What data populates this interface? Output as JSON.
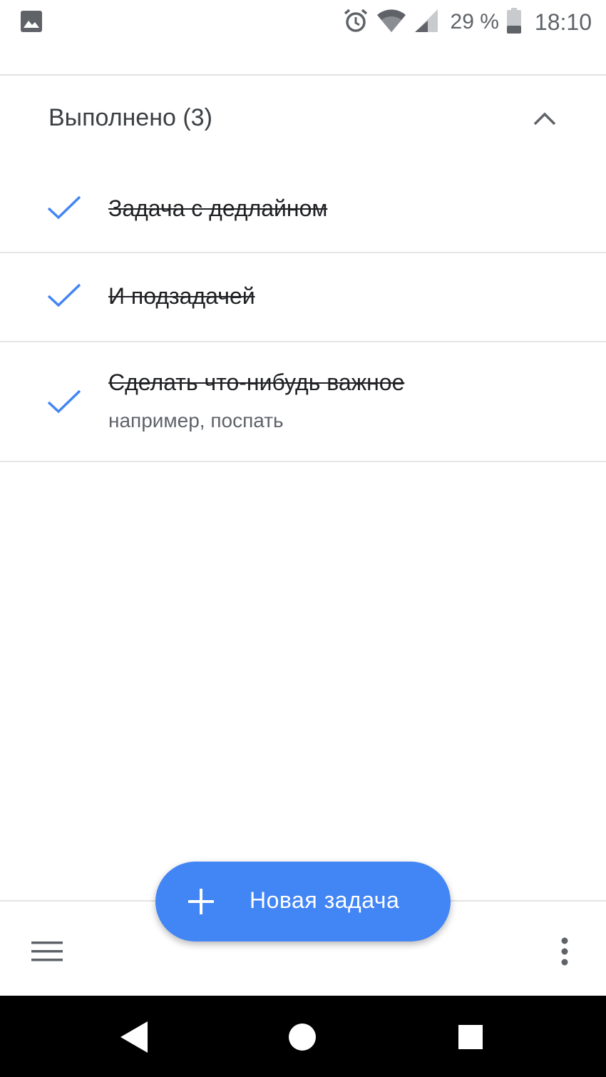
{
  "status_bar": {
    "left_icon": "image-icon",
    "icons": [
      "alarm-icon",
      "wifi-icon",
      "signal-icon"
    ],
    "battery_text": "29 %",
    "battery_icon": "battery-icon",
    "time": "18:10"
  },
  "completed_section": {
    "title": "Выполнено (3)",
    "collapse_icon": "chevron-up-icon",
    "tasks": [
      {
        "title": "Задача с дедлайном",
        "note": "",
        "done": true
      },
      {
        "title": "И подзадачей",
        "note": "",
        "done": true
      },
      {
        "title": "Сделать что-нибудь важное",
        "note": "например, поспать",
        "done": true
      }
    ]
  },
  "bottom_bar": {
    "menu_icon": "menu-icon",
    "more_icon": "more-vert-icon"
  },
  "fab": {
    "icon": "plus-icon",
    "label": "Новая задача"
  },
  "nav_bar": {
    "back_icon": "back-icon",
    "home_icon": "home-icon",
    "recents_icon": "recents-icon"
  },
  "colors": {
    "accent": "#4285f4",
    "check": "#4285f4",
    "text": "#202124",
    "secondary_text": "#5f6368",
    "divider": "#e6e6e6",
    "nav_bar": "#000000"
  }
}
